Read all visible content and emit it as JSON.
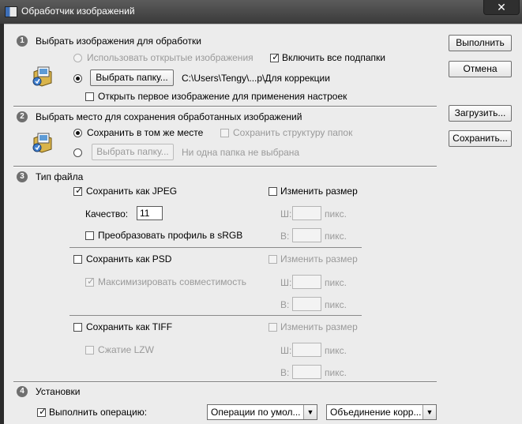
{
  "window": {
    "title": "Обработчик изображений"
  },
  "side_buttons": {
    "run": "Выполнить",
    "cancel": "Отмена",
    "load": "Загрузить...",
    "save": "Сохранить..."
  },
  "section1": {
    "number": "1",
    "title": "Выбрать изображения для обработки",
    "use_open_images": "Использовать открытые изображения",
    "include_subfolders": "Включить все подпапки",
    "choose_folder_button": "Выбрать папку...",
    "folder_path": "C:\\Users\\Tengy\\...p\\Для коррекции",
    "open_first_image": "Открыть первое изображение для применения настроек"
  },
  "section2": {
    "number": "2",
    "title": "Выбрать место для сохранения обработанных изображений",
    "save_same_place": "Сохранить в том же месте",
    "keep_folder_structure": "Сохранить структуру папок",
    "choose_folder_button": "Выбрать папку...",
    "no_folder_selected": "Ни одна папка не выбрана"
  },
  "section3": {
    "number": "3",
    "title": "Тип файла",
    "jpeg": {
      "save_as": "Сохранить как JPEG",
      "resize": "Изменить размер",
      "quality_label": "Качество:",
      "quality_value": "11",
      "convert_srgb": "Преобразовать профиль в sRGB",
      "w_label": "Ш:",
      "h_label": "В:",
      "unit": "пикс."
    },
    "psd": {
      "save_as": "Сохранить как PSD",
      "resize": "Изменить размер",
      "maximize_compat": "Максимизировать совместимость",
      "w_label": "Ш:",
      "h_label": "В:",
      "unit": "пикс."
    },
    "tiff": {
      "save_as": "Сохранить как TIFF",
      "resize": "Изменить размер",
      "lzw": "Сжатие LZW",
      "w_label": "Ш:",
      "h_label": "В:",
      "unit": "пикс."
    }
  },
  "section4": {
    "number": "4",
    "title": "Установки",
    "run_action": "Выполнить операцию:",
    "action_set": "Операции по умол...",
    "action": "Объединение корр..."
  },
  "icons": {
    "title": "photoshop-doc-icon",
    "section1": "image-folder-icon",
    "section2": "image-folder-icon",
    "close": "close-icon"
  }
}
